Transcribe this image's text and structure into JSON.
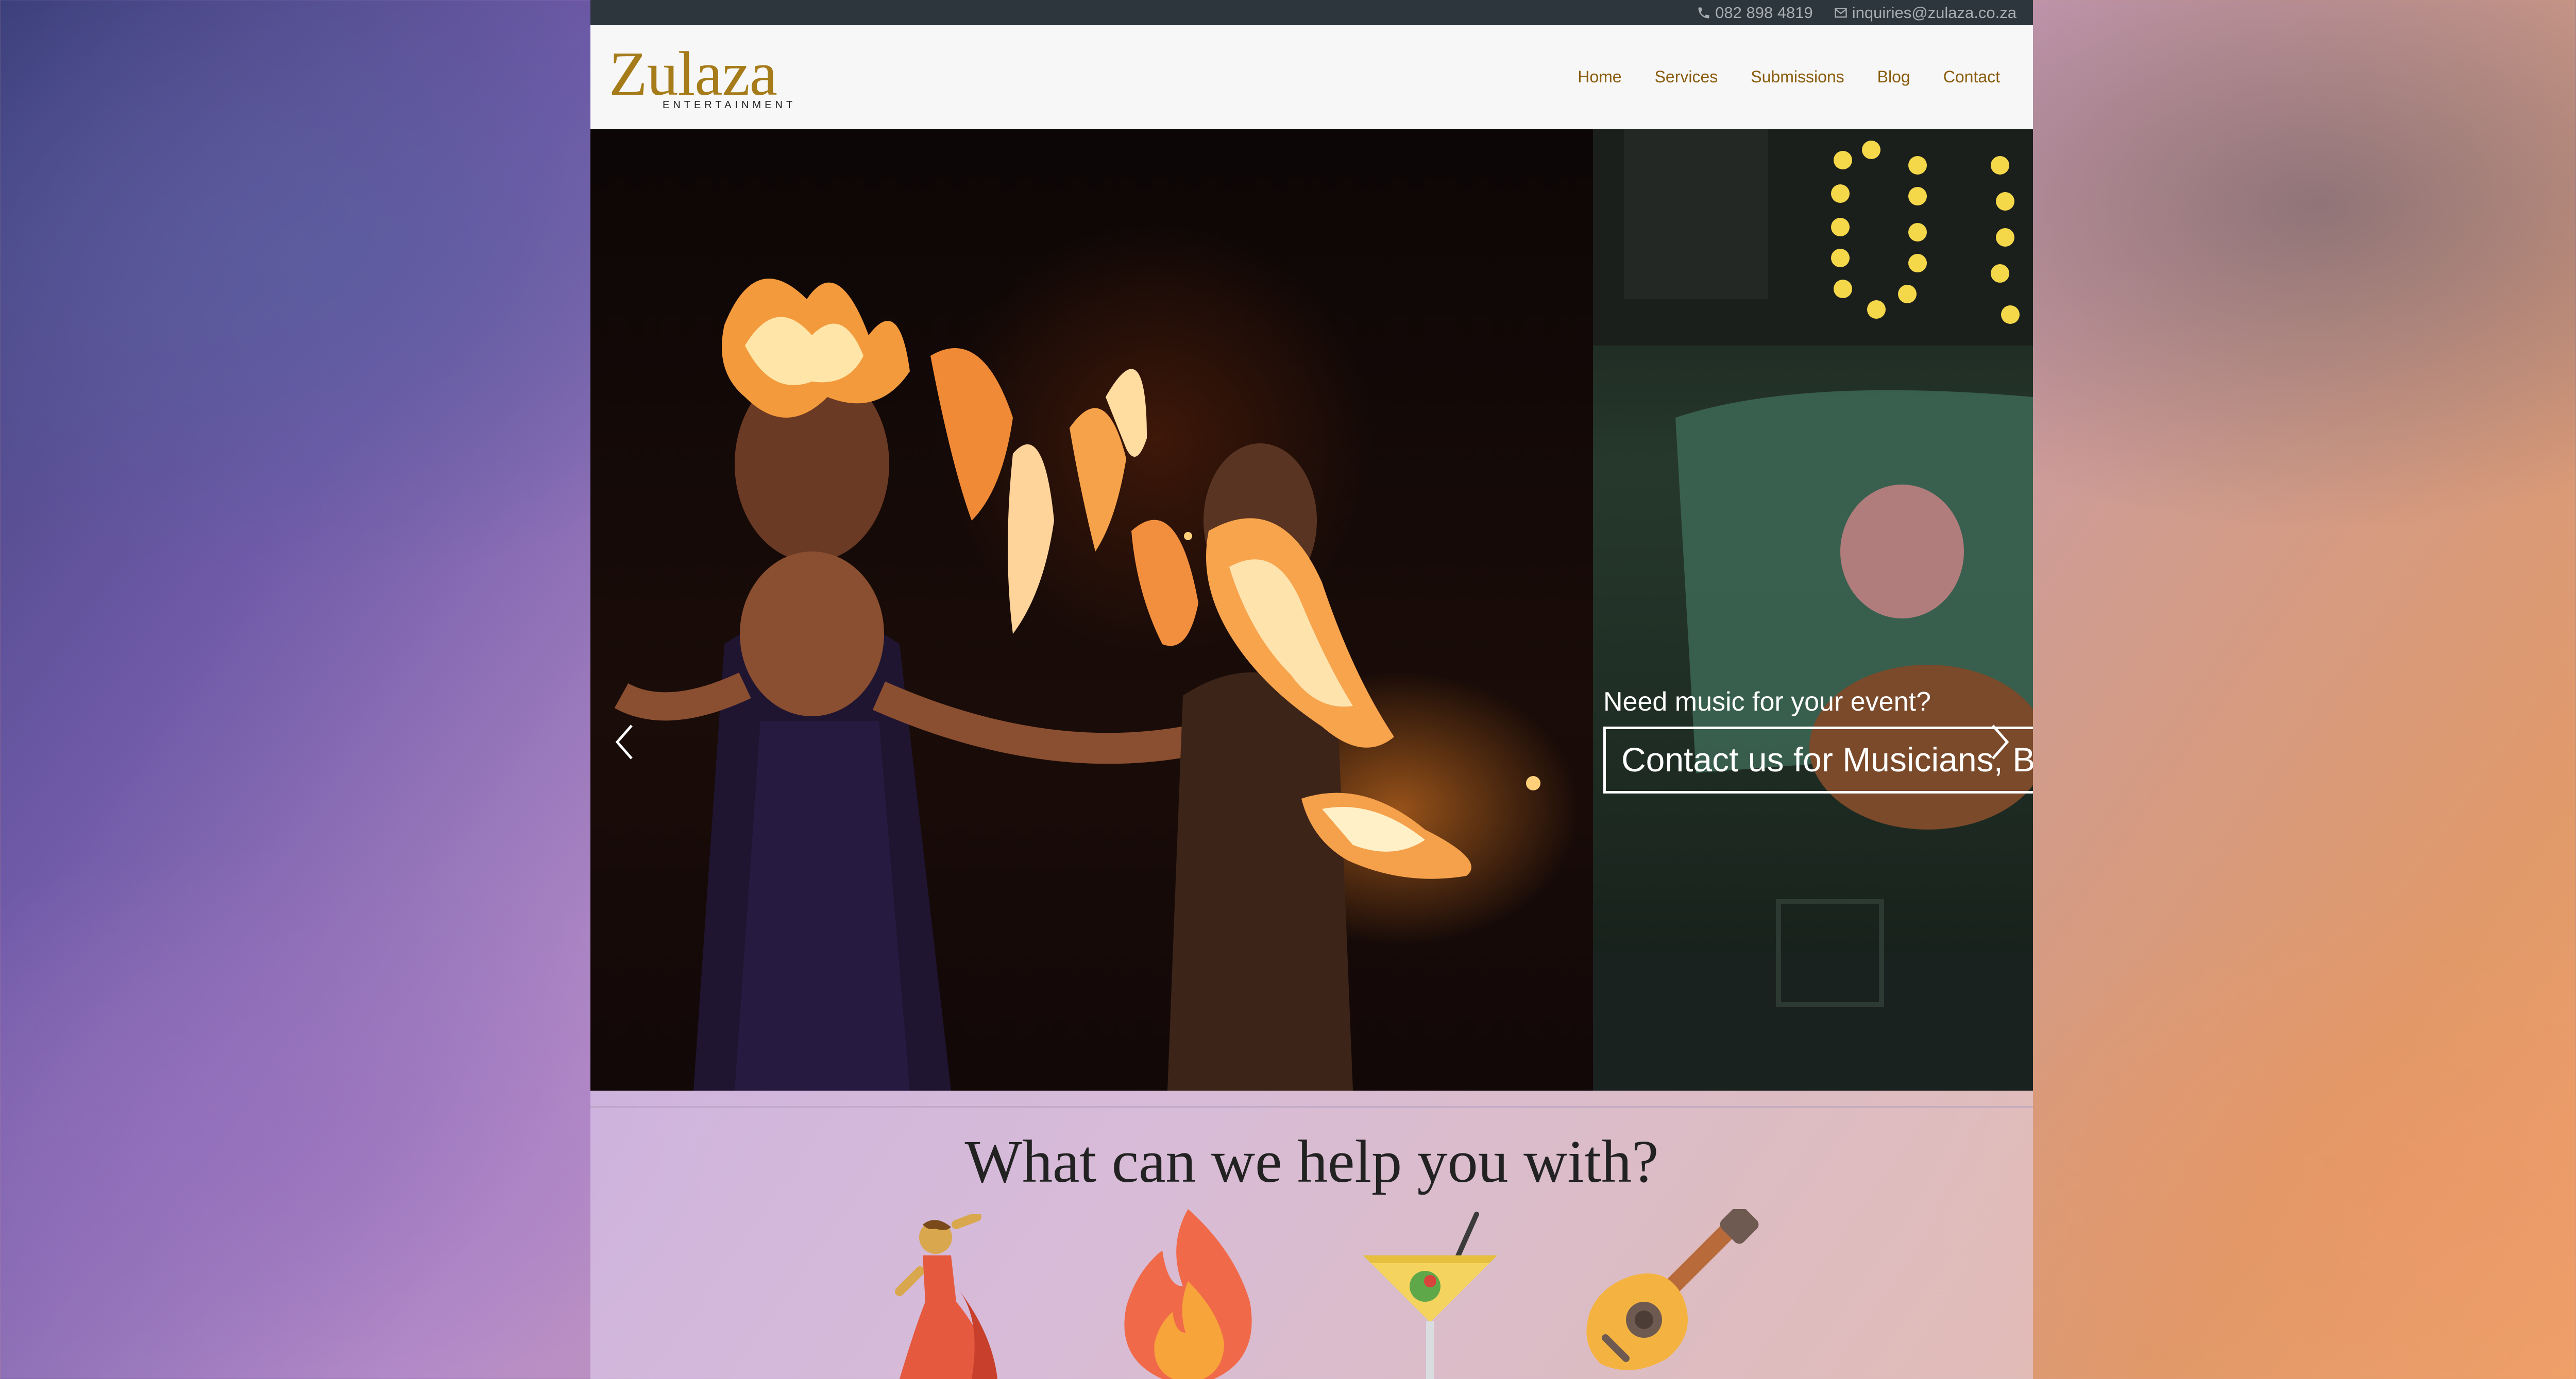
{
  "topbar": {
    "phone": "082 898 4819",
    "email": "inquiries@zulaza.co.za"
  },
  "logo": {
    "main": "Zulaza",
    "sub": "ENTERTAINMENT"
  },
  "nav": {
    "items": [
      "Home",
      "Services",
      "Submissions",
      "Blog",
      "Contact"
    ]
  },
  "hero": {
    "caption_small": "Need music for your event?",
    "caption_button": "Contact us for Musicians, Bands & DJs",
    "icons": [
      "chevron-left-icon",
      "chevron-right-icon"
    ]
  },
  "services": {
    "title": "What can we help you with?",
    "icons": [
      "dancer-icon",
      "fire-icon",
      "cocktail-icon",
      "guitar-icon"
    ]
  },
  "colors": {
    "topbar_bg": "#2e363d",
    "nav_text": "#8a5c0d",
    "logo_gold": "#a67c1a"
  }
}
